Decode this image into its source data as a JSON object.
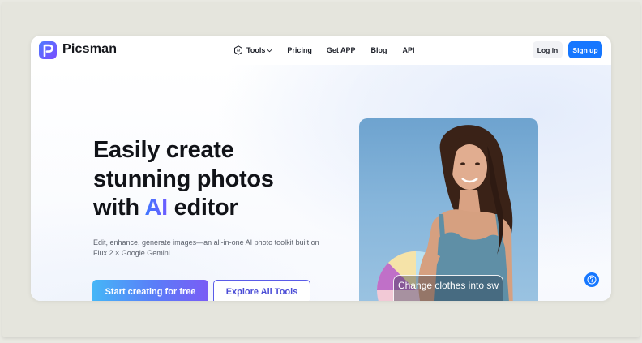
{
  "brand": {
    "name": "Picsman",
    "logo_letter": "P",
    "logo_color": "#4f7bff"
  },
  "nav": {
    "tools": "Tools",
    "pricing": "Pricing",
    "get_app": "Get APP",
    "blog": "Blog",
    "api": "API"
  },
  "auth": {
    "login": "Log in",
    "signup": "Sign up",
    "signup_color": "#1677ff"
  },
  "hero": {
    "line1": "Easily create",
    "line2": "stunning photos",
    "line3_before": "with ",
    "line3_ai": "AI",
    "line3_after": " editor",
    "subtext": "Edit, enhance, generate images—an all-in-one AI photo toolkit built on Flux 2 × Google Gemini.",
    "cta_primary": "Start creating for free",
    "cta_secondary": "Explore All Tools"
  },
  "photo": {
    "caption": "Change clothes into sw"
  },
  "help": {
    "icon": "question-icon"
  }
}
